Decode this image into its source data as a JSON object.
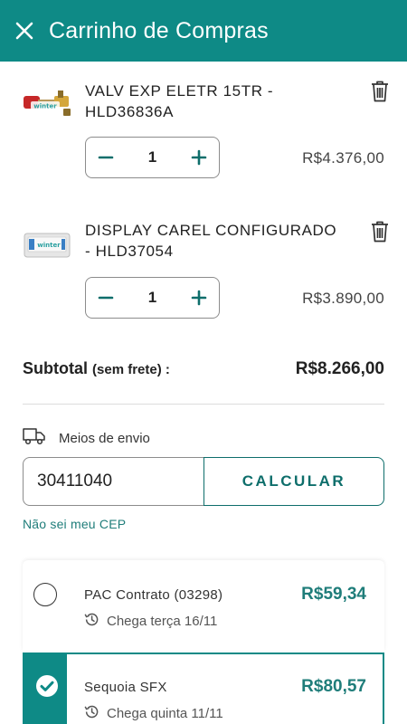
{
  "header": {
    "title": "Carrinho de Compras",
    "close_icon": "close-icon",
    "background": "#0e8a86"
  },
  "cart": {
    "items": [
      {
        "name": "VALV EXP ELETR 15TR - HLD36836A",
        "quantity": "1",
        "price": "R$4.376,00",
        "thumb_brand": "winter",
        "thumb_icon": "valve-product-image"
      },
      {
        "name": "DISPLAY CAREL CONFIGURADO - HLD37054",
        "quantity": "1",
        "price": "R$3.890,00",
        "thumb_brand": "winter",
        "thumb_icon": "display-product-image"
      }
    ],
    "subtotal_label": "Subtotal",
    "subtotal_note": "(sem frete) :",
    "subtotal_value": "R$8.266,00"
  },
  "shipping": {
    "label": "Meios de envio",
    "icon": "truck-icon",
    "cep_value": "30411040",
    "calculate_label": "CALCULAR",
    "cep_help_link": "Não sei meu CEP",
    "options": [
      {
        "name": "PAC Contrato (03298)",
        "price": "R$59,34",
        "eta": "Chega terça 16/11",
        "selected": false
      },
      {
        "name": "Sequoia SFX",
        "price": "R$80,57",
        "eta": "Chega quinta 11/11",
        "selected": true
      }
    ]
  },
  "colors": {
    "accent": "#0e8a86",
    "accent_text": "#1f7d7a"
  }
}
